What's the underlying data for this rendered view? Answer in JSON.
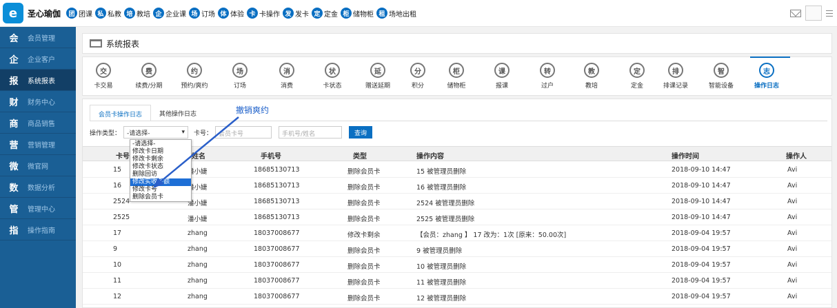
{
  "header": {
    "logo_text": "e",
    "brand": "圣心瑜伽",
    "nav": [
      {
        "icon": "团",
        "label": "团课"
      },
      {
        "icon": "私",
        "label": "私教"
      },
      {
        "icon": "培",
        "label": "教培"
      },
      {
        "icon": "企",
        "label": "企业课"
      },
      {
        "icon": "场",
        "label": "订场"
      },
      {
        "icon": "体",
        "label": "体验"
      },
      {
        "icon": "卡",
        "label": "卡操作"
      },
      {
        "icon": "发",
        "label": "发卡"
      },
      {
        "icon": "定",
        "label": "定金"
      },
      {
        "icon": "柜",
        "label": "储物柜"
      },
      {
        "icon": "租",
        "label": "场地出租"
      }
    ]
  },
  "sidebar": {
    "items": [
      {
        "icon": "会",
        "label": "会员管理"
      },
      {
        "icon": "企",
        "label": "企业客户"
      },
      {
        "icon": "报",
        "label": "系统报表"
      },
      {
        "icon": "财",
        "label": "财务中心"
      },
      {
        "icon": "商",
        "label": "商品销售"
      },
      {
        "icon": "营",
        "label": "营销管理"
      },
      {
        "icon": "微",
        "label": "微官网"
      },
      {
        "icon": "数",
        "label": "数据分析"
      },
      {
        "icon": "管",
        "label": "管理中心"
      },
      {
        "icon": "指",
        "label": "操作指南"
      }
    ],
    "active_index": 2
  },
  "page": {
    "title": "系统报表"
  },
  "modules": [
    {
      "icon": "交",
      "label": "卡交易"
    },
    {
      "icon": "费",
      "label": "续费/分期"
    },
    {
      "icon": "约",
      "label": "预约/爽约"
    },
    {
      "icon": "场",
      "label": "订场"
    },
    {
      "icon": "消",
      "label": "消费"
    },
    {
      "icon": "状",
      "label": "卡状态"
    },
    {
      "icon": "延",
      "label": "赠送延期"
    },
    {
      "icon": "分",
      "label": "积分"
    },
    {
      "icon": "柜",
      "label": "储物柜"
    },
    {
      "icon": "课",
      "label": "报课"
    },
    {
      "icon": "转",
      "label": "过户"
    },
    {
      "icon": "教",
      "label": "教培"
    },
    {
      "icon": "定",
      "label": "定金"
    },
    {
      "icon": "排",
      "label": "排课记录"
    },
    {
      "icon": "智",
      "label": "智能设备"
    },
    {
      "icon": "志",
      "label": "操作日志"
    }
  ],
  "tabs": [
    "会员卡操作日志",
    "其他操作日志"
  ],
  "annotation": "撤销爽约",
  "filter": {
    "type_label": "操作类型：",
    "type_value": "-请选择-",
    "card_label": "卡号：",
    "card_placeholder": "会员卡号",
    "phone_placeholder": "手机号/姓名",
    "search_button": "查询"
  },
  "dropdown_options": [
    "-请选择-",
    "修改卡日期",
    "修改卡剩余",
    "修改卡状态",
    "删除回访",
    "修改实收金额",
    "修改卡号",
    "删除会员卡"
  ],
  "dropdown_highlight": 5,
  "table": {
    "headers": [
      "卡号",
      "姓名",
      "手机号",
      "类型",
      "操作内容",
      "操作时间",
      "操作人"
    ],
    "rows": [
      [
        "15",
        "潘小婕",
        "18685130713",
        "删除会员卡",
        "15 被管理员删除",
        "2018-09-10 14:47",
        "Avi"
      ],
      [
        "16",
        "潘小婕",
        "18685130713",
        "删除会员卡",
        "16 被管理员删除",
        "2018-09-10 14:47",
        "Avi"
      ],
      [
        "2524",
        "潘小婕",
        "18685130713",
        "删除会员卡",
        "2524 被管理员删除",
        "2018-09-10 14:47",
        "Avi"
      ],
      [
        "2525",
        "潘小婕",
        "18685130713",
        "删除会员卡",
        "2525 被管理员删除",
        "2018-09-10 14:47",
        "Avi"
      ],
      [
        "17",
        "zhang",
        "18037008677",
        "修改卡剩余",
        "【会员：zhang 】 17 改为：1次 [原来：50.00次]",
        "2018-09-04 19:57",
        "Avi"
      ],
      [
        "9",
        "zhang",
        "18037008677",
        "删除会员卡",
        "9 被管理员删除",
        "2018-09-04 19:57",
        "Avi"
      ],
      [
        "10",
        "zhang",
        "18037008677",
        "删除会员卡",
        "10 被管理员删除",
        "2018-09-04 19:57",
        "Avi"
      ],
      [
        "11",
        "zhang",
        "18037008677",
        "删除会员卡",
        "11 被管理员删除",
        "2018-09-04 19:57",
        "Avi"
      ],
      [
        "12",
        "zhang",
        "18037008677",
        "删除会员卡",
        "12 被管理员删除",
        "2018-09-04 19:57",
        "Avi"
      ]
    ]
  }
}
